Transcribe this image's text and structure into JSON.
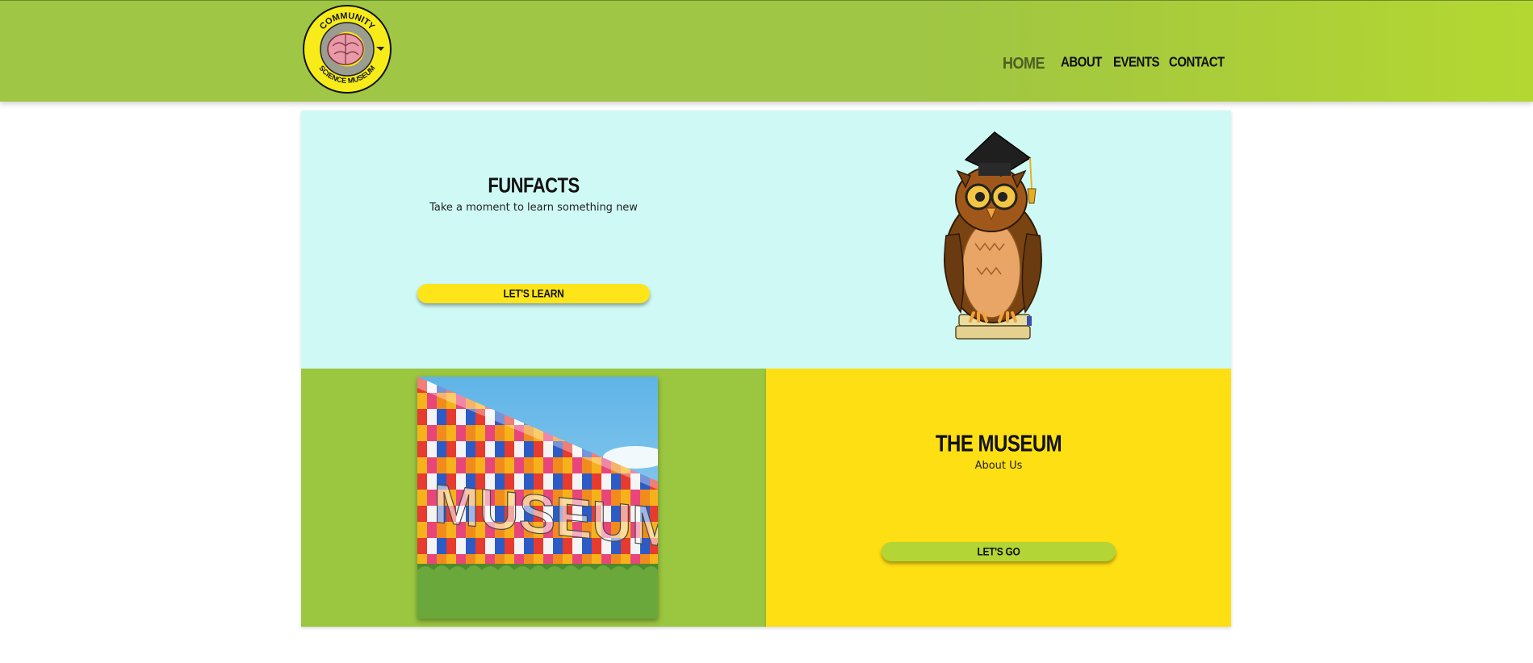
{
  "header": {
    "logo": {
      "text_top": "COMMUNITY",
      "text_bottom": "SCIENCE MUSEUM",
      "icon": "brain-icon"
    },
    "nav": [
      {
        "label": "HOME",
        "active": true
      },
      {
        "label": "ABOUT",
        "active": false
      },
      {
        "label": "EVENTS",
        "active": false
      },
      {
        "label": "CONTACT",
        "active": false
      }
    ]
  },
  "funfacts": {
    "title": "FUNFACTS",
    "subtitle": "Take a moment to learn something new",
    "button_label": "LET'S LEARN",
    "image": "owl-graduate-icon"
  },
  "museum": {
    "photo_text": "MUSEUM",
    "title": "THE MUSEUM",
    "subtitle": "About Us",
    "button_label": "LET'S GO"
  },
  "colors": {
    "header_green": "#9fc644",
    "cyan_panel": "#cff9f4",
    "green_panel": "#9bc640",
    "yellow_panel": "#fedf14",
    "yellow_button": "#fde51a",
    "green_button": "#b3d535"
  }
}
